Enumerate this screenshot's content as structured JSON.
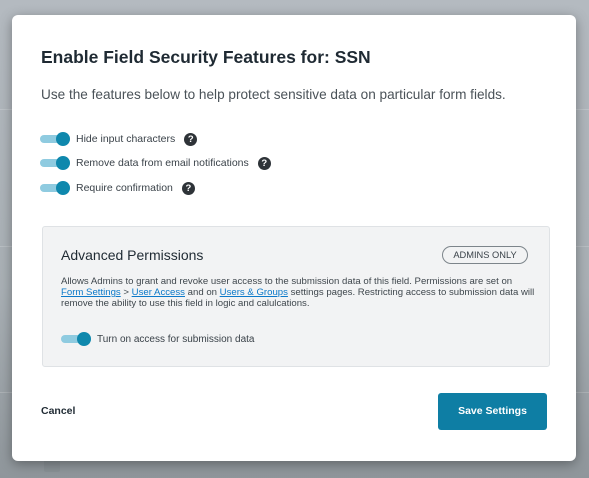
{
  "modal": {
    "title": "Enable Field Security Features for: SSN",
    "intro": "Use the features below to help protect sensitive data on particular form fields.",
    "help_glyph": "?",
    "features": [
      {
        "label": "Hide input characters",
        "enabled": true
      },
      {
        "label": "Remove data from email notifications",
        "enabled": true
      },
      {
        "label": "Require confirmation",
        "enabled": true
      }
    ],
    "advanced": {
      "title": "Advanced Permissions",
      "badge": "ADMINS ONLY",
      "desc_part1": "Allows Admins to grant and revoke user access to the submission data of this field. Permissions are set on ",
      "link_form_settings": "Form Settings",
      "desc_part2": " > ",
      "link_user_access": "User Access",
      "desc_part3": " and on ",
      "link_users_groups": "Users & Groups",
      "desc_part4": " settings pages. Restricting access to submission data will remove the ability to use this field in logic and calulcations.",
      "toggle_label": "Turn on access for submission data",
      "toggle_enabled": true
    },
    "cancel_label": "Cancel",
    "save_label": "Save Settings"
  },
  "colors": {
    "accent": "#0f88ad",
    "toggle_track": "#8fcbe0",
    "save_button": "#0e7ea4",
    "link": "#0b79c9"
  },
  "icons": {
    "help": "question-circle-icon"
  }
}
